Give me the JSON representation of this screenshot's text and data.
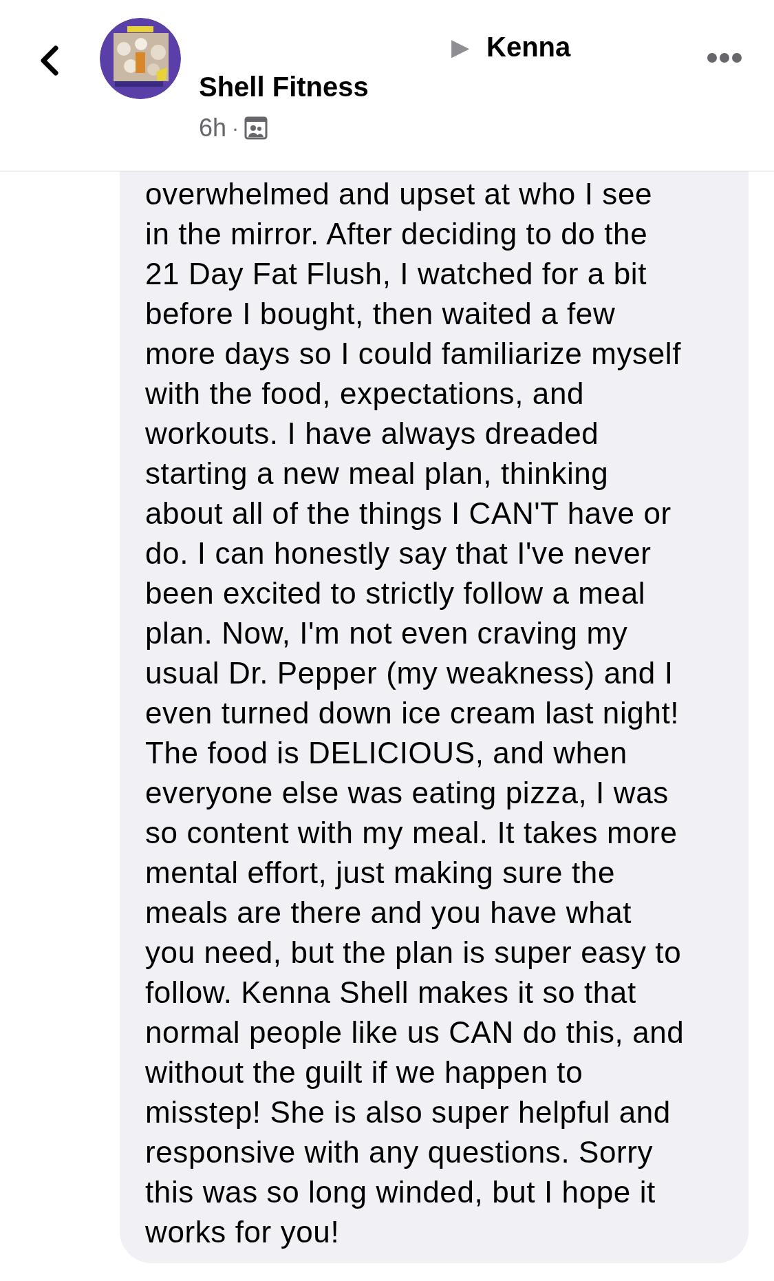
{
  "header": {
    "recipient": "Kenna",
    "arrow": "▶",
    "author": "Shell Fitness",
    "time": "6h",
    "separator": "·"
  },
  "comment": {
    "lines": [
      "overwhelmed and upset at who I see",
      "in the mirror. After deciding to do the",
      "21 Day Fat Flush, I watched for a bit",
      "before I bought, then waited a few",
      "more days so I could familiarize myself",
      "with the food, expectations, and",
      "workouts. I have always dreaded",
      "starting a new meal plan, thinking",
      "about all of the things I CAN'T have or",
      "do. I can honestly say that I've never",
      "been excited to strictly follow a meal",
      "plan. Now, I'm not even craving my",
      "usual Dr. Pepper (my weakness) and I",
      "even turned down ice cream last night!",
      "The food is DELICIOUS, and when",
      "everyone else was eating pizza, I was",
      "so content with my meal. It takes more",
      "mental effort, just making sure the",
      "meals are there and you have what",
      "you need, but the plan is super easy to",
      "follow. Kenna Shell makes it so that",
      "normal people like us CAN do this, and",
      "without the guilt if we happen to",
      "misstep! She is also super helpful and",
      "responsive with any questions. Sorry",
      "this was so long winded, but I hope it",
      "works for you!"
    ]
  }
}
